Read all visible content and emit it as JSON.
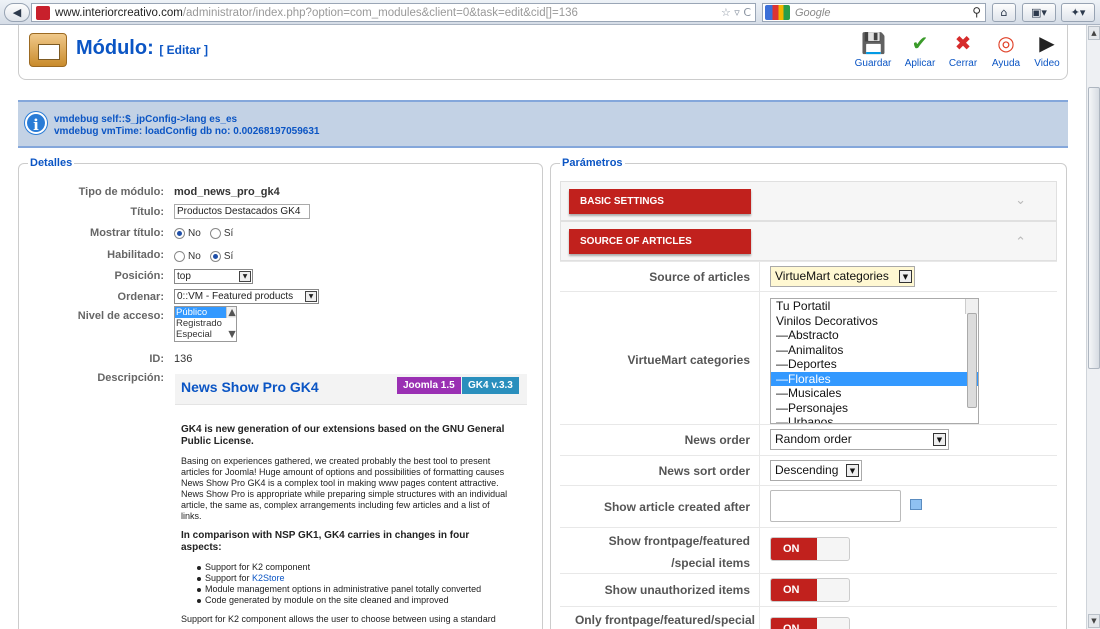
{
  "browser": {
    "back_glyph": "◀",
    "url_host": "www.interiorcreativo.com",
    "url_path": "/administrator/index.php?option=com_modules&client=0&task=edit&cid[]=136",
    "url_icons": "☆ ▿ C",
    "search_placeholder": "Google",
    "magnify_glyph": "⚲",
    "home_glyph": "⌂",
    "ext1_glyph": "▣▾",
    "ext2_glyph": "✦▾"
  },
  "toolbar": {
    "title": "Módulo:",
    "subtitle": "[ Editar ]",
    "buttons": [
      {
        "label": "Guardar",
        "glyph": "💾",
        "color": "#222222"
      },
      {
        "label": "Aplicar",
        "glyph": "✔",
        "color": "#3a9b2a"
      },
      {
        "label": "Cerrar",
        "glyph": "✖",
        "color": "#d62b2b"
      },
      {
        "label": "Ayuda",
        "glyph": "◎",
        "color": "#e0432a"
      },
      {
        "label": "Video",
        "glyph": "▶",
        "color": "#222222"
      }
    ]
  },
  "notice": {
    "line1": "vmdebug self::$_jpConfig->lang es_es",
    "line2": "vmdebug vmTime: loadConfig db no: 0.00268197059631"
  },
  "detalles": {
    "legend": "Detalles",
    "tipo_label": "Tipo de módulo:",
    "tipo_value": "mod_news_pro_gk4",
    "titulo_label": "Título:",
    "titulo_value": "Productos Destacados GK4",
    "mostrar_label": "Mostrar título:",
    "habilitado_label": "Habilitado:",
    "no": "No",
    "si": "Sí",
    "posicion_label": "Posición:",
    "posicion_value": "top",
    "ordenar_label": "Ordenar:",
    "ordenar_value": "0::VM - Featured products",
    "nivel_label": "Nivel de acceso:",
    "nivel_options": [
      "Público",
      "Registrado",
      "Especial"
    ],
    "id_label": "ID:",
    "id_value": "136",
    "descripcion_label": "Descripción:"
  },
  "description": {
    "title": "News Show Pro GK4",
    "badge1": "Joomla 1.5",
    "badge2": "GK4 v.3.3",
    "p1": "GK4 is new generation of our extensions based on the GNU General Public License.",
    "p2": "Basing on experiences gathered, we created probably the best tool to present articles for Joomla! Huge amount of options and possibilities of formatting causes News Show Pro GK4 is a complex tool in making www pages content attractive. News Show Pro is appropriate while preparing simple structures with an individual article, the same as, complex arrangements including few articles and a list of links.",
    "p3": "In comparison with NSP GK1, GK4 carries in changes in four aspects:",
    "li1": "Support for K2 component",
    "li2_prefix": "Support for ",
    "li2_link": "K2Store",
    "li3": "Module management options in administrative panel totally converted",
    "li4": "Code generated by module on the site cleaned and improved",
    "p4": "Support for K2 component allows the user to choose between using a standard"
  },
  "params": {
    "legend": "Parámetros",
    "basic_settings": "BASIC SETTINGS",
    "source_of_articles": "SOURCE OF ARTICLES",
    "chevron_down": "⌄",
    "chevron_up": "⌃",
    "source_label": "Source of articles",
    "source_value": "VirtueMart categories",
    "categories_label": "VirtueMart categories",
    "categories": [
      "Tu Portatil",
      "Vinilos Decorativos",
      "—Abstracto",
      "—Animalitos",
      "—Deportes",
      "—Florales",
      "—Musicales",
      "—Personajes",
      "—Urbanos"
    ],
    "news_order_label": "News order",
    "news_order_value": "Random order",
    "sort_order_label": "News sort order",
    "sort_order_value": "Descending",
    "created_after_label": "Show article created after",
    "frontpage_label_1": "Show frontpage/featured",
    "frontpage_label_2": "/special items",
    "unauthorized_label": "Show unauthorized items",
    "only_frontpage_label": "Only frontpage/featured/special",
    "toggle_on": "ON"
  },
  "colors": {
    "link_blue": "#0b55c4",
    "accent_red": "#c1211d"
  }
}
